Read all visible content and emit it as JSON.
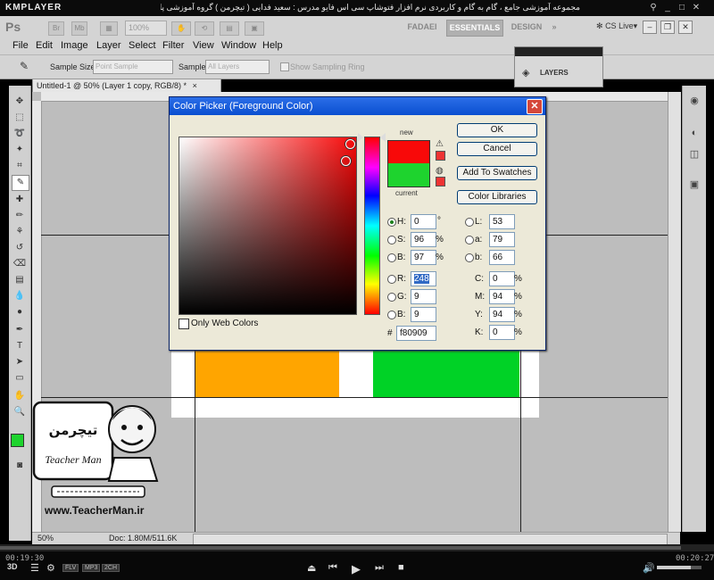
{
  "player": {
    "logo": "KMPLAYER",
    "caption": "مجموعه آموزشی جامع ، گام به گام و کاربردی نرم افزار فتوشاپ سی اس فایو  مدرس : سعید فدایی ( تیچرمن ) گروه آموزشی پادشاه گرافیست ها",
    "time_elapsed": "00:19:30",
    "time_total": "00:20:27",
    "badges": [
      "FLV",
      "MP3",
      "2CH"
    ]
  },
  "appbar": {
    "logo": "Ps",
    "btn_br": "Br",
    "btn_mb": "Mb",
    "zoom": "100%",
    "workspaces": [
      "FADAEI",
      "ESSENTIALS",
      "DESIGN"
    ],
    "cslive": "CS Live"
  },
  "menu": [
    "File",
    "Edit",
    "Image",
    "Layer",
    "Select",
    "Filter",
    "View",
    "Window",
    "Help"
  ],
  "options": {
    "sample_size_label": "Sample Size:",
    "sample_size_value": "Point Sample",
    "sample_label": "Sample:",
    "sample_value": "All Layers",
    "show_ring": "Show Sampling Ring"
  },
  "layers_panel": {
    "title": "LAYERS"
  },
  "document": {
    "tab": "Untitled-1 @ 50% (Layer 1 copy, RGB/8) *",
    "zoom": "50%",
    "doc_size": "Doc: 1.80M/511.6K",
    "orange": "#ffa500",
    "green": "#00d226"
  },
  "picker": {
    "title": "Color Picker (Foreground Color)",
    "label_new": "new",
    "label_current": "current",
    "color_new": "#f80909",
    "color_current": "#1ed32e",
    "buttons": {
      "ok": "OK",
      "cancel": "Cancel",
      "add_swatches": "Add To Swatches",
      "libraries": "Color Libraries"
    },
    "only_web": "Only Web Colors",
    "hsb": [
      {
        "label": "H:",
        "value": "0",
        "unit": "°",
        "selected": true
      },
      {
        "label": "S:",
        "value": "96",
        "unit": "%"
      },
      {
        "label": "B:",
        "value": "97",
        "unit": "%"
      }
    ],
    "rgb": [
      {
        "label": "R:",
        "value": "248"
      },
      {
        "label": "G:",
        "value": "9"
      },
      {
        "label": "B:",
        "value": "9"
      }
    ],
    "lab": [
      {
        "label": "L:",
        "value": "53"
      },
      {
        "label": "a:",
        "value": "79"
      },
      {
        "label": "b:",
        "value": "66"
      }
    ],
    "cmyk": [
      {
        "label": "C:",
        "value": "0",
        "unit": "%"
      },
      {
        "label": "M:",
        "value": "94",
        "unit": "%"
      },
      {
        "label": "Y:",
        "value": "94",
        "unit": "%"
      },
      {
        "label": "K:",
        "value": "0",
        "unit": "%"
      }
    ],
    "hex_label": "#",
    "hex": "f80909"
  },
  "teacher": {
    "brand": "Teacher Man",
    "url": "www.TeacherMan.ir"
  }
}
